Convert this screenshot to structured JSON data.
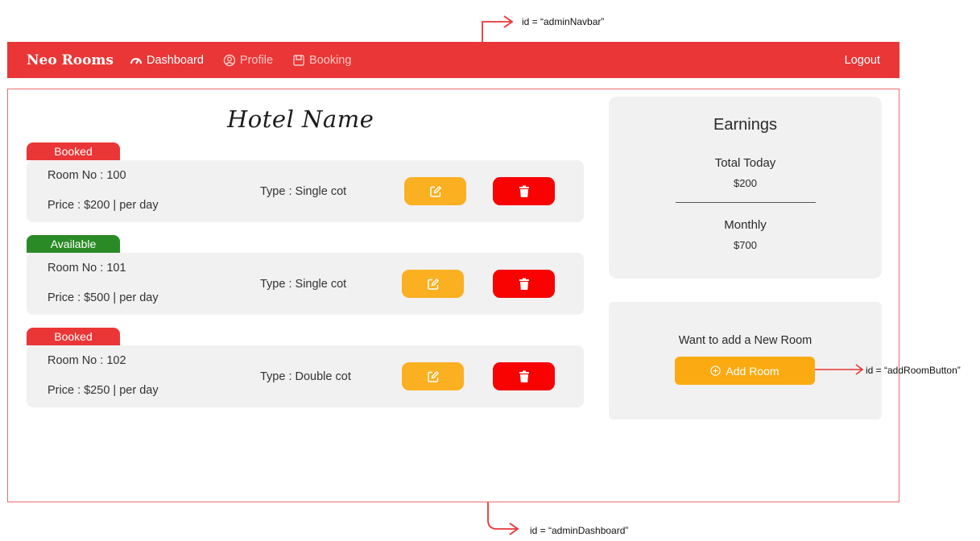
{
  "annotations": {
    "navbar_id": "id = “adminNavbar”",
    "dashboard_id": "id = “adminDashboard”",
    "add_room_id": "id = “addRoomButton”"
  },
  "navbar": {
    "brand": "Neo Rooms",
    "items": [
      {
        "label": "Dashboard",
        "icon": "gauge-icon"
      },
      {
        "label": "Profile",
        "icon": "user-circle-icon"
      },
      {
        "label": "Booking",
        "icon": "booking-icon"
      }
    ],
    "logout": "Logout"
  },
  "dashboard": {
    "hotel_name": "Hotel Name",
    "rooms": [
      {
        "status": "Booked",
        "room_no": "Room No : 100",
        "price": "Price : $200 | per day",
        "type": "Type : Single cot"
      },
      {
        "status": "Available",
        "room_no": "Room No : 101",
        "price": "Price : $500 | per day",
        "type": "Type : Single cot"
      },
      {
        "status": "Booked",
        "room_no": "Room No : 102",
        "price": "Price : $250 | per day",
        "type": "Type : Double cot"
      }
    ],
    "earnings": {
      "title": "Earnings",
      "total_today_label": "Total Today",
      "total_today_value": "$200",
      "monthly_label": "Monthly",
      "monthly_value": "$700"
    },
    "add_room": {
      "prompt": "Want to add a New Room",
      "button_label": "Add Room"
    }
  },
  "colors": {
    "navbar": "#ea3636",
    "booked": "#ea3636",
    "available": "#2a8a25",
    "edit": "#fbb022",
    "delete": "#f90202",
    "add_button": "#fbaa12"
  }
}
